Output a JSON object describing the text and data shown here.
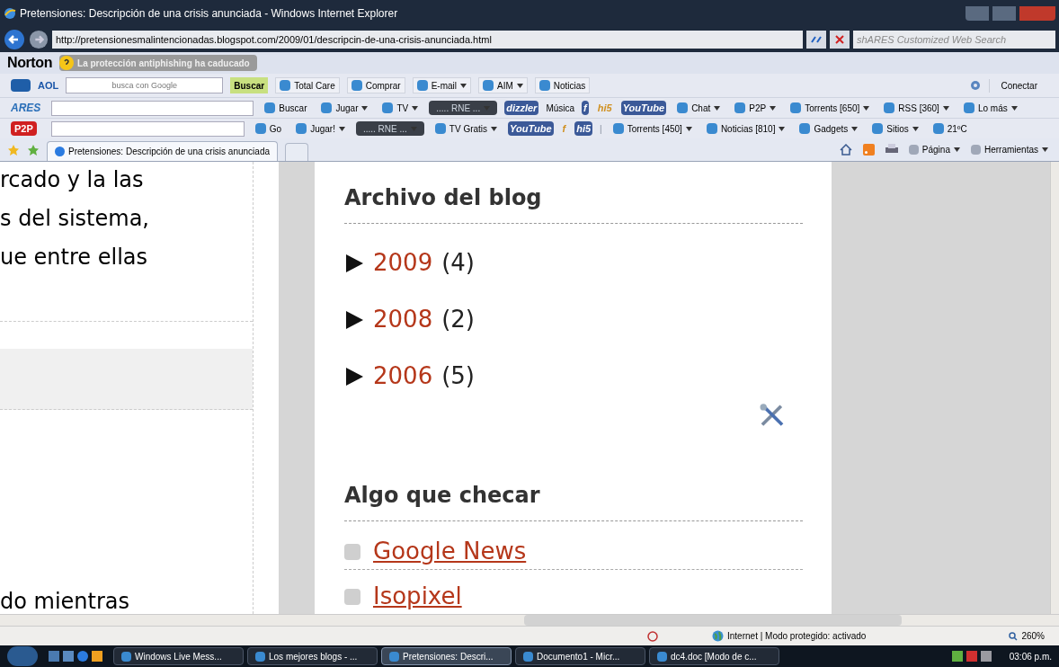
{
  "window": {
    "title": "Pretensiones: Descripción de una crisis anunciada - Windows Internet Explorer"
  },
  "address_bar": {
    "url": "http://pretensionesmalintencionadas.blogspot.com/2009/01/descripcin-de-una-crisis-anunciada.html",
    "search_placeholder": "shARES Customized Web Search"
  },
  "norton_toolbar": {
    "brand": "Norton",
    "alert": "La protección antiphishing ha caducado"
  },
  "aol_toolbar": {
    "brand": "AOL",
    "search_placeholder": "busca con Google",
    "search_button": "Buscar",
    "items": [
      {
        "kind": "button",
        "label": "Total Care",
        "dropdown": false
      },
      {
        "kind": "button",
        "label": "Comprar",
        "dropdown": false
      },
      {
        "kind": "button",
        "label": "E-mail",
        "dropdown": true
      },
      {
        "kind": "button",
        "label": "AIM",
        "dropdown": true
      },
      {
        "kind": "button",
        "label": "Noticias",
        "dropdown": false
      }
    ],
    "connect": "Conectar"
  },
  "ares_toolbar": {
    "brand": "ARES",
    "items": [
      {
        "kind": "button",
        "label": "Buscar",
        "dropdown": false
      },
      {
        "kind": "button",
        "label": "Jugar",
        "dropdown": true
      },
      {
        "kind": "button",
        "label": "TV",
        "dropdown": true
      },
      {
        "kind": "radio",
        "label": "..... RNE ...",
        "dropdown": true
      },
      {
        "kind": "logo",
        "label": "dizzler",
        "dropdown": false
      },
      {
        "kind": "text",
        "label": "Música",
        "dropdown": false
      },
      {
        "kind": "logo",
        "label": "f",
        "dropdown": false
      },
      {
        "kind": "logo",
        "label": "hi5",
        "dropdown": false
      },
      {
        "kind": "logo",
        "label": "YouTube",
        "dropdown": false
      },
      {
        "kind": "button",
        "label": "Chat",
        "dropdown": true
      },
      {
        "kind": "button",
        "label": "P2P",
        "dropdown": true
      },
      {
        "kind": "button",
        "label": "Torrents [650]",
        "dropdown": true
      },
      {
        "kind": "button",
        "label": "RSS [360]",
        "dropdown": true
      },
      {
        "kind": "button",
        "label": "Lo más",
        "dropdown": true
      }
    ]
  },
  "p2p_toolbar": {
    "brand": "P2P",
    "items": [
      {
        "kind": "button",
        "label": "Go",
        "dropdown": false
      },
      {
        "kind": "button",
        "label": "Jugar!",
        "dropdown": true
      },
      {
        "kind": "radio",
        "label": "..... RNE ...",
        "dropdown": true
      },
      {
        "kind": "button",
        "label": "TV Gratis",
        "dropdown": true
      },
      {
        "kind": "logo",
        "label": "YouTube",
        "dropdown": false
      },
      {
        "kind": "logo",
        "label": "f",
        "dropdown": false
      },
      {
        "kind": "logo",
        "label": "hi5",
        "dropdown": false
      },
      {
        "kind": "separator",
        "label": "|",
        "dropdown": false
      },
      {
        "kind": "button",
        "label": "Torrents [450]",
        "dropdown": true
      },
      {
        "kind": "button",
        "label": "Noticias [810]",
        "dropdown": true
      },
      {
        "kind": "button",
        "label": "Gadgets",
        "dropdown": true
      },
      {
        "kind": "button",
        "label": "Sitios",
        "dropdown": true
      },
      {
        "kind": "button",
        "label": "21ºC",
        "dropdown": false
      }
    ]
  },
  "tabs": [
    {
      "title": "Pretensiones: Descripción de una crisis anunciada",
      "selected": true
    }
  ],
  "command_bar": {
    "items": [
      {
        "label": "Página"
      },
      {
        "label": "Herramientas"
      }
    ]
  },
  "article": {
    "lines": [
      "rcado y la las",
      "s del sistema,",
      "ue entre ellas"
    ],
    "bottom_line": "do mientras"
  },
  "sidebar": {
    "sections": [
      {
        "title": "Archivo del blog",
        "kind": "archive",
        "items": [
          {
            "year": "2009",
            "count": "(4)",
            "expanded": false
          },
          {
            "year": "2008",
            "count": "(2)",
            "expanded": false
          },
          {
            "year": "2006",
            "count": "(5)",
            "expanded": false
          }
        ]
      },
      {
        "title": "Algo que checar",
        "kind": "links",
        "items": [
          {
            "label": "Google News"
          },
          {
            "label": "Isopixel"
          }
        ]
      }
    ]
  },
  "status_bar": {
    "zone": "Internet | Modo protegido: activado",
    "zoom": "260%"
  },
  "taskbar": {
    "items": [
      {
        "label": "Windows Live Mess...",
        "selected": false
      },
      {
        "label": "Los mejores blogs - ...",
        "selected": false
      },
      {
        "label": "Pretensiones: Descri...",
        "selected": true
      },
      {
        "label": "Documento1 - Micr...",
        "selected": false
      },
      {
        "label": "dc4.doc [Modo de c...",
        "selected": false
      }
    ],
    "clock": "03:06 p.m."
  }
}
